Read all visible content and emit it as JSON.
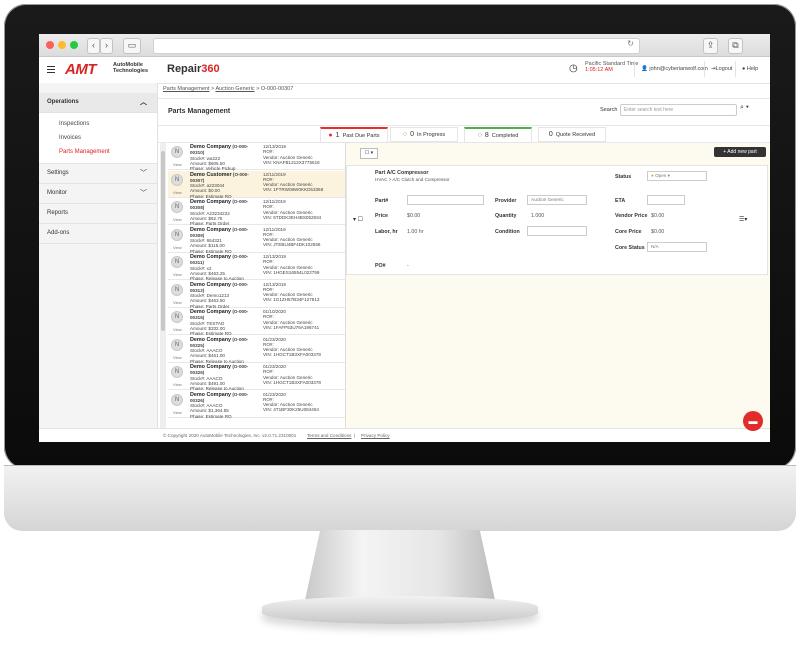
{
  "header": {
    "logo": "AMT",
    "logo_sub_1": "AutoMobile",
    "logo_sub_2": "Technologies",
    "app_name_1": "Repair",
    "app_name_2": "360",
    "timezone": "Pacific Standard Time",
    "time": "1:05:12 AM",
    "user": "john@cyberianwolf.com",
    "logout": "Logout",
    "help": "Help"
  },
  "sidebar": {
    "operations": "Operations",
    "subitems": [
      "Inspections",
      "Invoices",
      "Parts Management"
    ],
    "settings": "Settings",
    "monitor": "Monitor",
    "reports": "Reports",
    "addons": "Add-ons"
  },
  "breadcrumb": {
    "a": "Parts Management",
    "b": "Auction Generic",
    "c": "O-000-00307"
  },
  "page": {
    "title": "Parts Management",
    "search_label": "Search",
    "search_placeholder": "Enter search text here"
  },
  "status_tabs": [
    {
      "count": "1",
      "label": "Past Due Parts",
      "color": "#e03030"
    },
    {
      "count": "0",
      "label": "In Progress",
      "color": "#4caf50"
    },
    {
      "count": "8",
      "label": "Completed",
      "color": "#4caf50"
    },
    {
      "count": "0",
      "label": "Quote Received",
      "color": "#999999"
    }
  ],
  "orders": [
    {
      "name": "Demo Company",
      "id": "(O-000-00310)",
      "date": "12/13/2019",
      "stock": "Stock#: wa222",
      "col2b": "RO#:",
      "amount": "Amount: $605.50",
      "vendor": "Vendor: Auction Generic",
      "phase": "Phase: Vehicle Pickup",
      "vin": "VIN: KNAFB1212X3775516"
    },
    {
      "name": "Demo Customer",
      "id": "(O-000-00307)",
      "date": "12/11/2019",
      "stock": "Stock#: a223044",
      "col2b": "RO#:",
      "amount": "Amount: $0.00",
      "vendor": "Vendor: Auction Generic",
      "phase": "Phase: Estimate RO",
      "vin": "VIN: 1FTRW08W0KKD53368"
    },
    {
      "name": "Demo Company",
      "id": "(O-000-00308)",
      "date": "12/11/2019",
      "stock": "Stock#: A23234222",
      "col2b": "RO#:",
      "amount": "Amount: $62.75",
      "vendor": "Vendor: Auction Generic",
      "phase": "Phase: Parts Order",
      "vin": "VIN: 5TDDK3EH4BS052934"
    },
    {
      "name": "Demo Company",
      "id": "(O-000-00309)",
      "date": "12/11/2019",
      "stock": "Stock#: 654321",
      "col2b": "RO#:",
      "amount": "Amount: $115.00",
      "vendor": "Vendor: Auction Generic",
      "phase": "Phase: Estimate RO",
      "vin": "VIN: JTEBU4BF4DK102556"
    },
    {
      "name": "Demo Company",
      "id": "(O-000-00311)",
      "date": "12/13/2019",
      "stock": "Stock#: x2",
      "col2b": "RO#:",
      "amount": "Amount: $463.25",
      "vendor": "Vendor: Auction Generic",
      "phase": "Phase: Release to Auction",
      "vin": "VIN: 1HGES16554L022759"
    },
    {
      "name": "Demo Company",
      "id": "(O-000-00312)",
      "date": "12/13/2019",
      "stock": "Stock#: Demo1213",
      "col2b": "RO#:",
      "amount": "Amount: $463.50",
      "vendor": "Vendor: Auction Generic",
      "phase": "Phase: Parts Order",
      "vin": "VIN: 1G1ZH57B34F127813"
    },
    {
      "name": "Demo Company",
      "id": "(O-000-00316)",
      "date": "01/10/2020",
      "stock": "Stock#: TESTAD",
      "col2b": "RO#:",
      "amount": "Amount: $332.00",
      "vendor": "Vendor: Auction Generic",
      "phase": "Phase: Estimate RO",
      "vin": "VIN: 1FAFP53U76A196741"
    },
    {
      "name": "Demo Company",
      "id": "(O-000-00325)",
      "date": "01/23/2020",
      "stock": "Stock#: AAACO",
      "col2b": "RO#:",
      "amount": "Amount: $451.00",
      "vendor": "Vendor: Auction Generic",
      "phase": "Phase: Release to Auction",
      "vin": "VIN: 1HGCT1B3XFA003378"
    },
    {
      "name": "Demo Company",
      "id": "(O-000-00326)",
      "date": "01/23/2020",
      "stock": "Stock#: AAACO",
      "col2b": "RO#:",
      "amount": "Amount: $491.00",
      "vendor": "Vendor: Auction Generic",
      "phase": "Phase: Release to Auction",
      "vin": "VIN: 1HGCT1B3XFA003378"
    },
    {
      "name": "Demo Company",
      "id": "(O-000-00326)",
      "date": "01/23/2020",
      "stock": "Stock#: AAACO",
      "col2b": "RO#:",
      "amount": "Amount: $1,364.55",
      "vendor": "Vendor: Auction Generic",
      "phase": "Phase: Estimate RO",
      "vin": "VIN: 4T1BF30K25U084464"
    }
  ],
  "avatar_letter": "N",
  "view_label": "View",
  "detail": {
    "add_button": "+ Add new part",
    "part_title": "Part A/C Compressor",
    "part_path": "HVAC > A/C Clutch and Compressor",
    "status_label": "Status",
    "status_value": "Open",
    "part_no_label": "Part#",
    "provider_label": "Provider",
    "provider_value": "Auction Generic",
    "eta_label": "ETA",
    "price_label": "Price",
    "price_value": "$0.00",
    "quantity_label": "Quantity",
    "quantity_value": "1.000",
    "vendor_price_label": "Vendor Price",
    "vendor_price_value": "$0.00",
    "labor_label": "Labor, hr",
    "labor_value": "1.00 hr",
    "condition_label": "Condition",
    "core_price_label": "Core Price",
    "core_price_value": "$0.00",
    "core_status_label": "Core Status",
    "core_status_value": "N/A",
    "po_label": "PO#",
    "po_value": "-"
  },
  "footer": {
    "copyright": "© Copyright 2020 AutoMobile Technologies, Inc.  v2.0.71.2310001",
    "terms": "Terms and Conditions",
    "privacy": "Privacy Policy"
  }
}
